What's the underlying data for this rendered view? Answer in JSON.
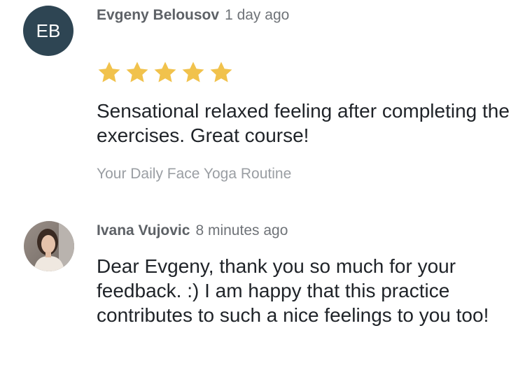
{
  "reviews": [
    {
      "initials": "EB",
      "author": "Evgeny Belousov",
      "time": "1 day ago",
      "rating": 5,
      "rating_max": 5,
      "text": "Sensational relaxed feeling after completing the exercises. Great course!",
      "course": "Your Daily Face Yoga Routine"
    }
  ],
  "reply": {
    "author": "Ivana Vujovic",
    "time": "8 minutes ago",
    "text": "Dear Evgeny, thank you so much for your feedback. :) I am happy that this practice contributes to such a nice feelings to you too!"
  },
  "colors": {
    "avatar_bg": "#2e4553",
    "star": "#f1c24c"
  },
  "icons": {
    "star": "star-icon",
    "avatar_photo": "profile-photo"
  }
}
